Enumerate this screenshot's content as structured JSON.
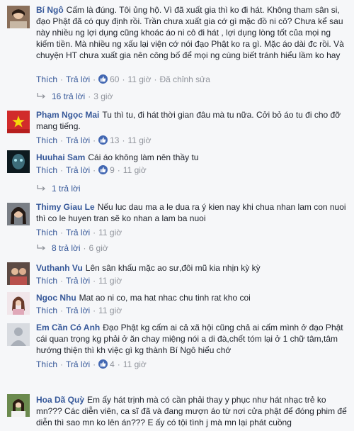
{
  "actions": {
    "like": "Thích",
    "reply": "Trả lời",
    "separator": "·"
  },
  "colors": {
    "link": "#365899",
    "meta": "#90949c",
    "like_badge": "#4267b2",
    "background": "#f6f7f9"
  },
  "comments": [
    {
      "author": "Bí Ngô",
      "text": "Cấm là đúng. Tôi ủng hộ. Vì đã xuất gia thì ko đi hát. Không tham sân si, đạo Phật đã có quy định rồi. Trần chưa xuất gia cớ gì mặc đồ ni cô? Chưa kể sau này nhiều ng lợi dụng cũng khoác áo ni cô đi hát , lợi dụng lòng tốt của mọi ng kiếm tiền. Mà nhiều ng xấu lại viện cớ nói đạo Phật ko ra gì. Mặc áo dài đc rồi. Và chuyện HT chưa xuất gia nên công bố để mọi ng cùng biết tránh hiểu lầm ko hay",
      "likes": "60",
      "time": "11 giờ",
      "edited": "Đã chỉnh sửa",
      "replies": {
        "count": "16 trả lời",
        "time": "3 giờ"
      }
    },
    {
      "author": "Phạm Ngọc Mai",
      "text": "Tu thì tu, đi hát thời gian đâu mà tu nữa. Cởi bỏ áo tu đi cho đỡ mang tiếng.",
      "likes": "13",
      "time": "11 giờ"
    },
    {
      "author": "Huuhai Sam",
      "text": "Cái áo không làm nên thầy tu",
      "likes": "9",
      "time": "11 giờ",
      "replies": {
        "count": "1 trả lời"
      }
    },
    {
      "author": "Thimy Giau Le",
      "text": "Nếu luc dau ma a le dua ra ý kien nay khi chua nhan lam con nuoi thì co le huyen tran sẽ ko nhan a lam ba nuoi",
      "likes": "",
      "time": "11 giờ",
      "replies": {
        "count": "8 trả lời",
        "time": "6 giờ"
      }
    },
    {
      "author": "Vuthanh Vu",
      "text": "Lên sân khấu mặc ao sư,đôi mũ kia nhịn kỳ kỳ",
      "likes": "",
      "time": "11 giờ"
    },
    {
      "author": "Ngoc Nhu",
      "text": "Mat ao ni co, ma hat nhac chu tinh rat kho coi",
      "likes": "",
      "time": "11 giờ"
    },
    {
      "author": "Em Cần Có Anh",
      "text": "Đạo Phật kg cấm ai cả xã hội cũng chả ai cấm mình ở đạo Phật cái quan trọng kg phải ở ăn chay miệng nói a di đà,chết tóm lại ở 1 chữ tâm,tâm hướng thiện thì kh việc gì kg thành Bí Ngô hiểu chớ",
      "likes": "4",
      "time": "11 giờ"
    },
    {
      "author": "Hoa Dã Quỳ",
      "text": "Em ấy hát trịnh mà có cần phải thay y phục như hát nhạc trẻ ko mn??? Các diễn viên, ca sĩ đã và đang mượn áo từ nơi cửa phật để đóng phim để diễn thì sao mn ko lên án??? E ấy có tội tình j mà mn lại phát cuồng",
      "likes": "",
      "time": ""
    }
  ]
}
